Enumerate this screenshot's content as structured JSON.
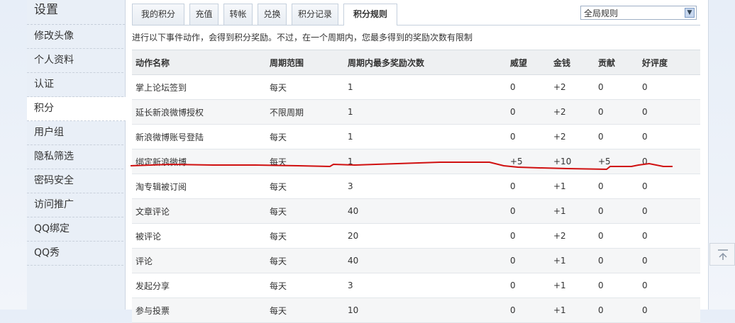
{
  "sidebar": {
    "title": "设置",
    "items": [
      "修改头像",
      "个人资料",
      "认证",
      "积分",
      "用户组",
      "隐私筛选",
      "密码安全",
      "访问推广",
      "QQ绑定",
      "QQ秀"
    ],
    "active_index": 3
  },
  "tabs": {
    "items": [
      "我的积分",
      "充值",
      "转帐",
      "兑换",
      "积分记录",
      "积分规则"
    ],
    "active_index": 5
  },
  "rule_select": {
    "value": "全局规则"
  },
  "description": "进行以下事件动作，会得到积分奖励。不过，在一个周期内，您最多得到的奖励次数有限制",
  "table": {
    "headers": [
      "动作名称",
      "周期范围",
      "周期内最多奖励次数",
      "威望",
      "金钱",
      "贡献",
      "好评度"
    ],
    "rows": [
      [
        "掌上论坛签到",
        "每天",
        "1",
        "0",
        "+2",
        "0",
        "0"
      ],
      [
        "延长新浪微博授权",
        "不限周期",
        "1",
        "0",
        "+2",
        "0",
        "0"
      ],
      [
        "新浪微博账号登陆",
        "每天",
        "1",
        "0",
        "+2",
        "0",
        "0"
      ],
      [
        "绑定新浪微博",
        "每天",
        "1",
        "+5",
        "+10",
        "+5",
        "0"
      ],
      [
        "淘专辑被订阅",
        "每天",
        "3",
        "0",
        "+1",
        "0",
        "0"
      ],
      [
        "文章评论",
        "每天",
        "40",
        "0",
        "+1",
        "0",
        "0"
      ],
      [
        "被评论",
        "每天",
        "20",
        "0",
        "+2",
        "0",
        "0"
      ],
      [
        "评论",
        "每天",
        "40",
        "0",
        "+1",
        "0",
        "0"
      ],
      [
        "发起分享",
        "每天",
        "3",
        "0",
        "+1",
        "0",
        "0"
      ],
      [
        "参与投票",
        "每天",
        "10",
        "0",
        "+1",
        "0",
        "0"
      ]
    ]
  },
  "colors": {
    "annotation_line": "#d01010",
    "sidebar_bg": "#e9eff7"
  },
  "icons": {
    "back_to_top": "up-arrow-icon",
    "select_arrow": "chevron-down-icon"
  }
}
